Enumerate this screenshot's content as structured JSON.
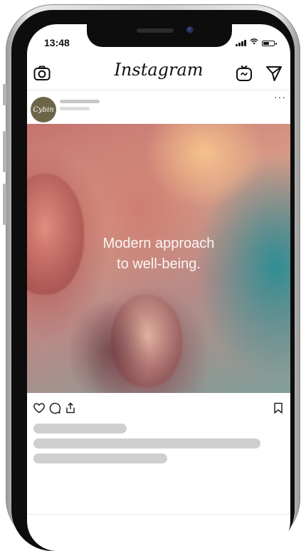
{
  "status_bar": {
    "time": "13:48",
    "signal_bars": 4,
    "battery_level": 0.6
  },
  "app": {
    "name": "Instagram",
    "header_icons": [
      "camera-icon",
      "igtv-icon",
      "direct-message-icon"
    ]
  },
  "post": {
    "avatar_text": "Cybin",
    "more_label": "···",
    "image_text_line1": "Modern approach",
    "image_text_line2": "to well-being.",
    "action_icons": [
      "heart-icon",
      "comment-icon",
      "share-icon",
      "bookmark-icon"
    ]
  },
  "colors": {
    "avatar_bg": "#6d6548",
    "skeleton": "#cfcfcf",
    "teal": "#288e94",
    "peach": "#f7c48c",
    "rose": "#ae4a4e"
  }
}
